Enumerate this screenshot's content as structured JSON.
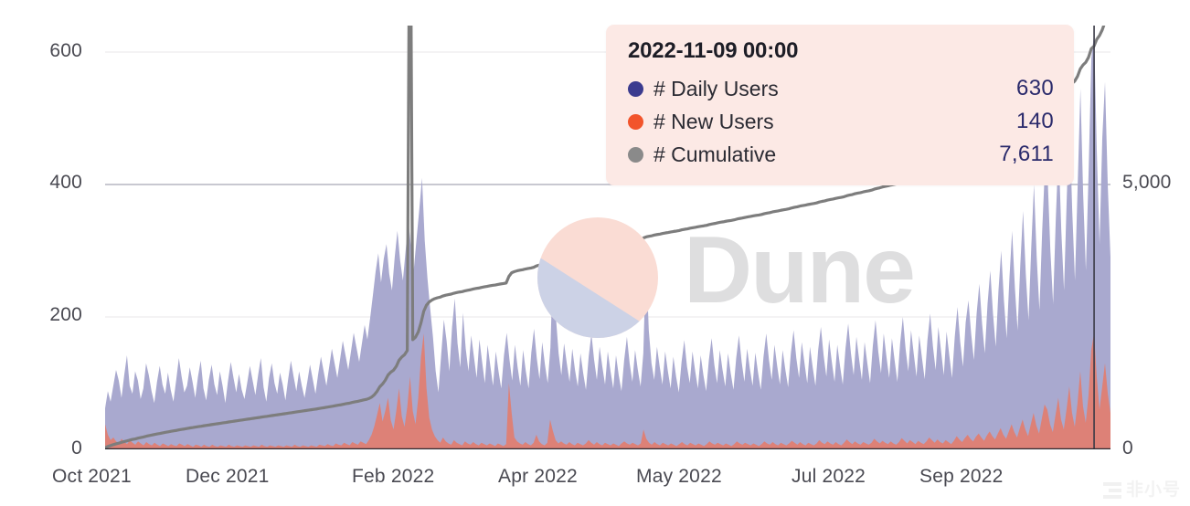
{
  "chart_data": {
    "type": "area",
    "title": "",
    "xlabel": "",
    "ylabel": "",
    "grid": true,
    "legend_position": "tooltip",
    "x_tick_labels": [
      "Oct 2021",
      "Dec 2021",
      "Feb 2022",
      "Apr 2022",
      "May 2022",
      "Jul 2022",
      "Sep 2022"
    ],
    "y_left_ticks": [
      "0",
      "200",
      "400",
      "600"
    ],
    "y_left_lim": [
      0,
      640
    ],
    "y_right_ticks": [
      "0",
      "5,000"
    ],
    "y_right_lim": [
      0,
      8000
    ],
    "series": [
      {
        "name": "# Daily Users",
        "type": "area",
        "axis": "left",
        "color": "#a9a9cf",
        "dot_color": "#3b3b8f",
        "values": [
          62,
          88,
          72,
          96,
          120,
          104,
          78,
          112,
          142,
          96,
          84,
          118,
          104,
          76,
          92,
          130,
          112,
          88,
          70,
          102,
          126,
          98,
          84,
          116,
          90,
          72,
          104,
          138,
          110,
          86,
          96,
          124,
          102,
          78,
          110,
          134,
          92,
          74,
          106,
          128,
          98,
          82,
          118,
          96,
          70,
          104,
          132,
          108,
          86,
          114,
          90,
          76,
          100,
          126,
          104,
          82,
          112,
          138,
          94,
          72,
          108,
          130,
          100,
          84,
          116,
          98,
          74,
          106,
          134,
          110,
          88,
          118,
          96,
          78,
          102,
          128,
          106,
          84,
          114,
          140,
          118,
          96,
          124,
          152,
          130,
          108,
          136,
          164,
          142,
          120,
          148,
          176,
          154,
          132,
          160,
          188,
          166,
          198,
          232,
          268,
          296,
          252,
          288,
          310,
          265,
          240,
          290,
          330,
          285,
          255,
          300,
          345,
          305,
          272,
          318,
          362,
          410,
          315,
          258,
          212,
          170,
          118,
          86,
          142,
          196,
          164,
          118,
          185,
          228,
          160,
          124,
          206,
          152,
          118,
          172,
          140,
          108,
          166,
          132,
          100,
          158,
          126,
          96,
          148,
          118,
          92,
          142,
          176,
          136,
          104,
          158,
          124,
          96,
          150,
          118,
          92,
          146,
          182,
          138,
          106,
          162,
          128,
          100,
          154,
          290,
          200,
          145,
          112,
          160,
          130,
          102,
          152,
          120,
          95,
          145,
          115,
          90,
          140,
          175,
          135,
          105,
          155,
          125,
          98,
          148,
          118,
          92,
          142,
          112,
          88,
          135,
          170,
          130,
          102,
          150,
          120,
          95,
          145,
          290,
          180,
          130,
          105,
          155,
          125,
          98,
          148,
          118,
          92,
          140,
          110,
          86,
          132,
          165,
          125,
          100,
          148,
          118,
          92,
          142,
          112,
          88,
          135,
          168,
          128,
          100,
          150,
          120,
          95,
          145,
          115,
          90,
          138,
          172,
          132,
          102,
          152,
          122,
          96,
          146,
          116,
          90,
          140,
          175,
          135,
          105,
          158,
          126,
          98,
          150,
          120,
          94,
          145,
          180,
          138,
          108,
          162,
          130,
          100,
          155,
          124,
          96,
          150,
          185,
          142,
          110,
          166,
          132,
          102,
          158,
          126,
          98,
          152,
          190,
          145,
          112,
          170,
          136,
          105,
          162,
          130,
          100,
          156,
          195,
          148,
          115,
          175,
          140,
          108,
          168,
          134,
          102,
          160,
          200,
          152,
          118,
          180,
          144,
          110,
          172,
          138,
          106,
          165,
          205,
          156,
          120,
          185,
          148,
          112,
          178,
          142,
          108,
          170,
          215,
          162,
          125,
          192,
          225,
          175,
          135,
          205,
          250,
          190,
          145,
          220,
          270,
          205,
          155,
          240,
          300,
          225,
          168,
          258,
          330,
          245,
          180,
          280,
          360,
          265,
          195,
          305,
          400,
          290,
          210,
          330,
          425,
          410,
          300,
          220,
          350,
          455,
          330,
          240,
          380,
          500,
          360,
          255,
          400,
          545,
          385,
          270,
          420,
          590,
          628,
          450,
          310,
          470,
          555,
          400,
          290
        ]
      },
      {
        "name": "# New Users",
        "type": "area",
        "axis": "left",
        "color": "#dd8177",
        "dot_color": "#f2542b",
        "values": [
          38,
          22,
          14,
          18,
          12,
          9,
          16,
          11,
          8,
          14,
          10,
          7,
          12,
          9,
          6,
          11,
          8,
          6,
          10,
          7,
          5,
          9,
          7,
          5,
          8,
          6,
          5,
          9,
          7,
          5,
          8,
          6,
          4,
          7,
          6,
          4,
          7,
          5,
          4,
          7,
          5,
          4,
          6,
          5,
          4,
          7,
          5,
          4,
          6,
          5,
          4,
          6,
          5,
          4,
          6,
          5,
          4,
          7,
          5,
          4,
          6,
          5,
          4,
          6,
          5,
          4,
          6,
          5,
          4,
          7,
          5,
          4,
          6,
          5,
          4,
          6,
          5,
          4,
          7,
          6,
          5,
          8,
          6,
          5,
          9,
          7,
          6,
          10,
          8,
          6,
          11,
          9,
          7,
          12,
          10,
          8,
          14,
          22,
          35,
          52,
          70,
          42,
          58,
          78,
          44,
          30,
          58,
          92,
          50,
          34,
          64,
          110,
          58,
          38,
          78,
          140,
          175,
          92,
          48,
          30,
          20,
          14,
          10,
          18,
          12,
          9,
          7,
          14,
          10,
          8,
          6,
          12,
          9,
          7,
          11,
          8,
          6,
          10,
          8,
          6,
          9,
          7,
          5,
          9,
          7,
          5,
          8,
          100,
          55,
          18,
          12,
          9,
          7,
          11,
          8,
          6,
          10,
          22,
          12,
          8,
          6,
          10,
          45,
          28,
          14,
          9,
          12,
          9,
          7,
          11,
          8,
          6,
          10,
          8,
          6,
          9,
          14,
          10,
          7,
          11,
          8,
          6,
          10,
          8,
          6,
          9,
          7,
          5,
          9,
          12,
          9,
          7,
          10,
          8,
          6,
          9,
          30,
          16,
          10,
          7,
          11,
          8,
          6,
          10,
          8,
          6,
          9,
          7,
          5,
          8,
          11,
          8,
          6,
          10,
          8,
          6,
          9,
          7,
          5,
          8,
          12,
          9,
          7,
          10,
          8,
          6,
          9,
          7,
          5,
          8,
          12,
          9,
          7,
          10,
          8,
          6,
          9,
          7,
          5,
          8,
          12,
          9,
          7,
          11,
          8,
          6,
          10,
          8,
          6,
          9,
          13,
          10,
          7,
          11,
          8,
          6,
          10,
          8,
          6,
          9,
          14,
          10,
          8,
          12,
          9,
          7,
          11,
          8,
          6,
          10,
          15,
          11,
          8,
          12,
          9,
          7,
          11,
          9,
          7,
          10,
          16,
          12,
          9,
          13,
          10,
          8,
          12,
          9,
          7,
          11,
          17,
          13,
          9,
          14,
          11,
          8,
          13,
          10,
          8,
          12,
          18,
          14,
          10,
          15,
          11,
          9,
          14,
          11,
          8,
          13,
          20,
          15,
          11,
          17,
          22,
          16,
          12,
          19,
          24,
          18,
          13,
          21,
          27,
          20,
          15,
          24,
          32,
          22,
          16,
          27,
          38,
          26,
          18,
          32,
          45,
          30,
          20,
          38,
          55,
          36,
          24,
          46,
          68,
          60,
          38,
          26,
          52,
          78,
          45,
          30,
          60,
          95,
          55,
          34,
          70,
          118,
          65,
          40,
          82,
          150,
          175,
          110,
          60,
          95,
          130,
          85,
          55
        ]
      },
      {
        "name": "# Cumulative",
        "type": "line",
        "axis": "right",
        "color": "#7d7d7d",
        "dot_color": "#8a8a8a",
        "values": [
          30,
          55,
          72,
          90,
          105,
          118,
          134,
          148,
          160,
          175,
          188,
          198,
          212,
          224,
          234,
          248,
          260,
          270,
          282,
          292,
          300,
          312,
          322,
          331,
          341,
          350,
          358,
          369,
          378,
          386,
          396,
          405,
          412,
          421,
          430,
          437,
          446,
          454,
          461,
          470,
          478,
          485,
          493,
          501,
          508,
          517,
          525,
          532,
          540,
          548,
          555,
          563,
          571,
          578,
          586,
          594,
          601,
          610,
          617,
          624,
          632,
          640,
          647,
          655,
          663,
          670,
          678,
          686,
          693,
          702,
          710,
          717,
          725,
          733,
          740,
          748,
          756,
          763,
          772,
          781,
          789,
          799,
          807,
          815,
          826,
          835,
          843,
          855,
          865,
          873,
          886,
          897,
          906,
          920,
          932,
          942,
          959,
          986,
          1030,
          1095,
          1182,
          1234,
          1306,
          1403,
          1458,
          1495,
          1567,
          1682,
          1744,
          1786,
          1866,
          11999,
          2071,
          2118,
          2215,
          2390,
          2608,
          2723,
          2783,
          2820,
          2845,
          2862,
          2874,
          2896,
          2911,
          2922,
          2931,
          2948,
          2960,
          2970,
          2978,
          2993,
          3004,
          3013,
          3027,
          3037,
          3045,
          3058,
          3068,
          3076,
          3087,
          3096,
          3103,
          3114,
          3123,
          3130,
          3140,
          3265,
          3334,
          3356,
          3371,
          3382,
          3391,
          3405,
          3415,
          3423,
          3436,
          3463,
          3478,
          3488,
          3496,
          3509,
          3565,
          3600,
          3618,
          3629,
          3644,
          3655,
          3664,
          3678,
          3688,
          3696,
          3708,
          3718,
          3726,
          3737,
          3755,
          3767,
          3776,
          3790,
          3800,
          3808,
          3820,
          3830,
          3838,
          3849,
          3858,
          3865,
          3876,
          3891,
          3902,
          3911,
          3924,
          3934,
          3942,
          3953,
          3991,
          4011,
          4023,
          4032,
          4046,
          4056,
          4064,
          4076,
          4086,
          4094,
          4105,
          4114,
          4121,
          4131,
          4145,
          4155,
          4163,
          4175,
          4185,
          4193,
          4204,
          4213,
          4220,
          4230,
          4245,
          4256,
          4265,
          4277,
          4287,
          4295,
          4306,
          4315,
          4322,
          4332,
          4347,
          4358,
          4367,
          4379,
          4389,
          4397,
          4408,
          4417,
          4424,
          4434,
          4449,
          4460,
          4469,
          4483,
          4493,
          4501,
          4513,
          4523,
          4531,
          4542,
          4558,
          4570,
          4579,
          4593,
          4603,
          4611,
          4623,
          4633,
          4641,
          4652,
          4669,
          4681,
          4691,
          4706,
          4717,
          4726,
          4739,
          4749,
          4757,
          4769,
          4787,
          4800,
          4810,
          4826,
          4837,
          4846,
          4860,
          4871,
          4880,
          4893,
          4912,
          4926,
          4937,
          4953,
          4965,
          4975,
          4989,
          5000,
          5009,
          5022,
          5042,
          5057,
          5069,
          5086,
          5099,
          5109,
          5124,
          5136,
          5146,
          5160,
          5181,
          5197,
          5209,
          5227,
          5241,
          5252,
          5268,
          5281,
          5292,
          5307,
          5330,
          5348,
          5362,
          5383,
          5408,
          5427,
          5442,
          5464,
          5494,
          5515,
          5531,
          5555,
          5586,
          5609,
          5627,
          5654,
          5690,
          5715,
          5734,
          5765,
          5806,
          5835,
          5856,
          5893,
          5943,
          5978,
          6003,
          6046,
          6106,
          6147,
          6174,
          6225,
          6298,
          6363,
          6406,
          6437,
          6494,
          6578,
          6631,
          6666,
          6733,
          6841,
          6908,
          6953,
          7042,
          7181,
          7256,
          7306,
          7400,
          7561,
          7611,
          7740,
          7812,
          7918,
          8067,
          8178,
          8248
        ]
      }
    ]
  },
  "tooltip": {
    "title": "2022-11-09 00:00",
    "rows": [
      {
        "label": "# Daily Users",
        "value": "630",
        "color": "#3b3b8f"
      },
      {
        "label": "# New Users",
        "value": "140",
        "color": "#f2542b"
      },
      {
        "label": "# Cumulative",
        "value": "7,611",
        "color": "#8a8a8a"
      }
    ],
    "background": "#fce9e5",
    "value_color": "#2a2a6b"
  },
  "crosshair": {
    "visible": true,
    "color": "#3a3a46"
  },
  "watermarks": {
    "brand_text": "Dune",
    "brand_color": "#dededf",
    "corner_text": "非小号"
  }
}
